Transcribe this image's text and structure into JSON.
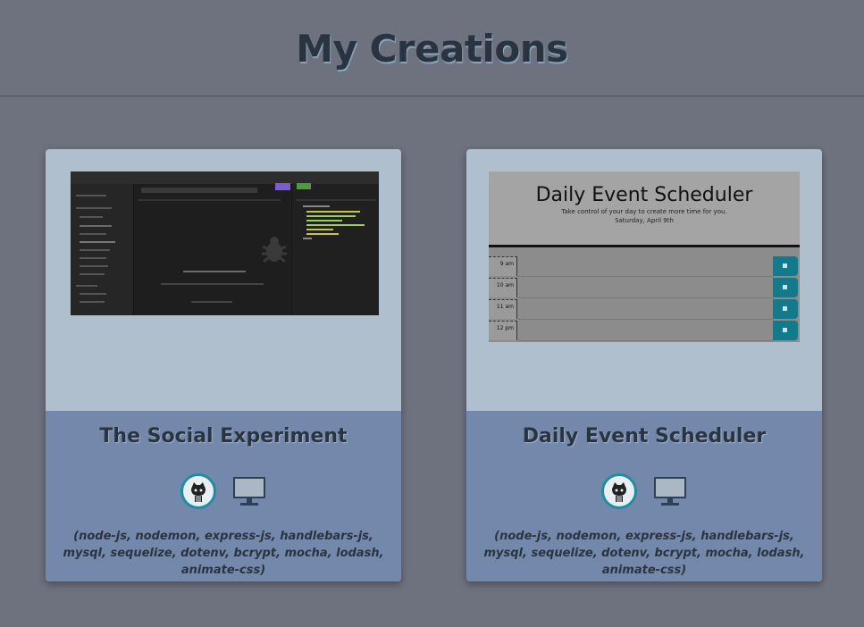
{
  "page": {
    "title": "My Creations"
  },
  "projects": [
    {
      "title": "The Social Experiment",
      "github_icon": "github-octocat-icon",
      "deploy_icon": "monitor-icon",
      "tech": "(node-js, nodemon, express-js, handlebars-js, mysql, sequelize, dotenv, bcrypt, mocha, lodash, animate-css)"
    },
    {
      "title": "Daily Event Scheduler",
      "github_icon": "github-octocat-icon",
      "deploy_icon": "monitor-icon",
      "tech": "(node-js, nodemon, express-js, handlebars-js, mysql, sequelize, dotenv, bcrypt, mocha, lodash, animate-css)",
      "preview": {
        "heading": "Daily Event Scheduler",
        "tagline": "Take control of your day to create more time for you.",
        "date": "Saturday, April 9th",
        "hours": [
          "9 am",
          "10 am",
          "11 am",
          "12 pm"
        ]
      }
    }
  ],
  "colors": {
    "background": "#6e717e",
    "card": "#b0bfcd",
    "card_info": "#7388aa",
    "accent": "#1f8ea0"
  }
}
